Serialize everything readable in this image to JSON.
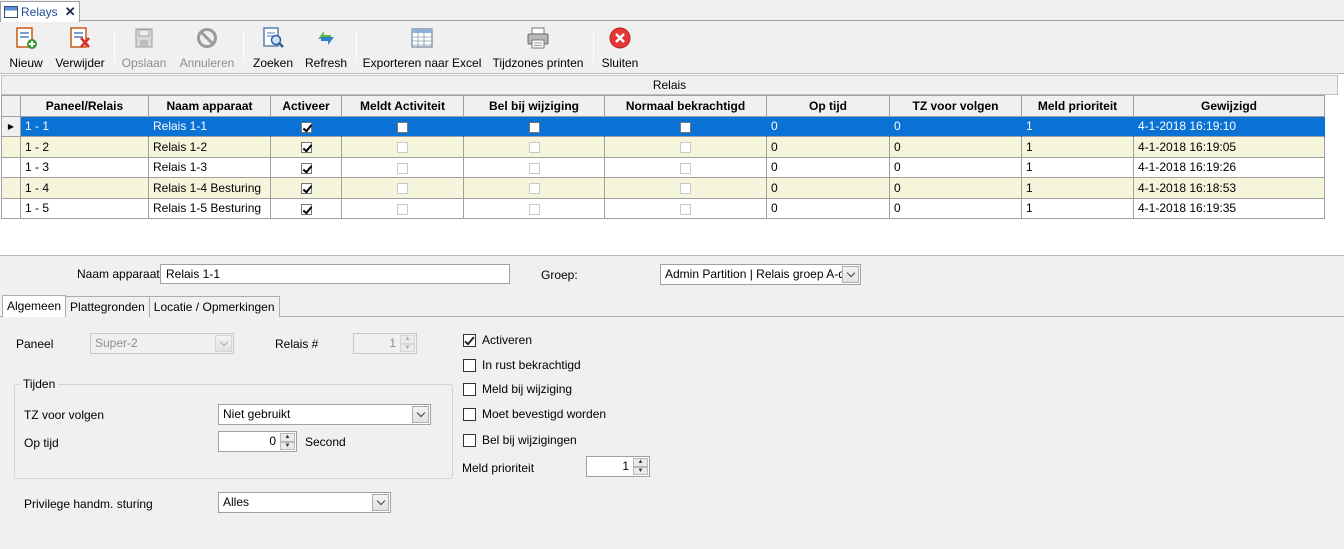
{
  "document_tab": {
    "title": "Relays",
    "close_glyph": "✕"
  },
  "toolbar": {
    "buttons": [
      {
        "label": "Nieuw",
        "icon": "new-record-icon",
        "enabled": true
      },
      {
        "label": "Verwijder",
        "icon": "delete-record-icon",
        "enabled": true
      },
      {
        "label": "Opslaan",
        "icon": "save-icon",
        "enabled": false
      },
      {
        "label": "Annuleren",
        "icon": "cancel-icon",
        "enabled": false
      },
      {
        "label": "Zoeken",
        "icon": "search-icon",
        "enabled": true
      },
      {
        "label": "Refresh",
        "icon": "refresh-icon",
        "enabled": true
      },
      {
        "label": "Exporteren naar Excel",
        "icon": "excel-export-icon",
        "enabled": true
      },
      {
        "label": "Tijdzones printen",
        "icon": "printer-icon",
        "enabled": true
      },
      {
        "label": "Sluiten",
        "icon": "close-circle-icon",
        "enabled": true
      }
    ]
  },
  "grid": {
    "group_title": "Relais",
    "columns": [
      "Paneel/Relais",
      "Naam apparaat",
      "Activeer",
      "Meldt Activiteit",
      "Bel bij wijziging",
      "Normaal bekrachtigd",
      "Op tijd",
      "TZ voor volgen",
      "Meld prioriteit",
      "Gewijzigd"
    ],
    "selected_row_marker": "▶",
    "rows": [
      {
        "panel": "1 - 1",
        "name": "Relais 1-1",
        "activeer": true,
        "meldt": false,
        "bel": false,
        "normaal": false,
        "optijd": "0",
        "tz": "0",
        "prio": "1",
        "gewijzigd": "4-1-2018 16:19:10",
        "selected": true
      },
      {
        "panel": "1 - 2",
        "name": "Relais 1-2",
        "activeer": true,
        "meldt": false,
        "bel": false,
        "normaal": false,
        "optijd": "0",
        "tz": "0",
        "prio": "1",
        "gewijzigd": "4-1-2018 16:19:05",
        "selected": false
      },
      {
        "panel": "1 - 3",
        "name": "Relais 1-3",
        "activeer": true,
        "meldt": false,
        "bel": false,
        "normaal": false,
        "optijd": "0",
        "tz": "0",
        "prio": "1",
        "gewijzigd": "4-1-2018 16:19:26",
        "selected": false
      },
      {
        "panel": "1 - 4",
        "name": "Relais 1-4 Besturing",
        "activeer": true,
        "meldt": false,
        "bel": false,
        "normaal": false,
        "optijd": "0",
        "tz": "0",
        "prio": "1",
        "gewijzigd": "4-1-2018 16:18:53",
        "selected": false
      },
      {
        "panel": "1 - 5",
        "name": "Relais 1-5 Besturing",
        "activeer": true,
        "meldt": false,
        "bel": false,
        "normaal": false,
        "optijd": "0",
        "tz": "0",
        "prio": "1",
        "gewijzigd": "4-1-2018 16:19:35",
        "selected": false
      }
    ]
  },
  "detail": {
    "name_label": "Naam apparaat",
    "name_value": "Relais 1-1",
    "group_label": "Groep:",
    "group_value": "Admin Partition | Relais groep A-d",
    "tabs": [
      "Algemeen",
      "Plattegronden",
      "Locatie / Opmerkingen"
    ],
    "paneel_label": "Paneel",
    "paneel_value": "Super-2",
    "relais_label": "Relais #",
    "relais_value": "1",
    "tijden_title": "Tijden",
    "tz_label": "TZ voor volgen",
    "tz_value": "Niet gebruikt",
    "optijd_label": "Op tijd",
    "optijd_value": "0",
    "optijd_unit": "Second",
    "privilege_label": "Privilege handm. sturing",
    "privilege_value": "Alles",
    "checkboxes": [
      {
        "label": "Activeren",
        "checked": true
      },
      {
        "label": "In rust bekrachtigd",
        "checked": false
      },
      {
        "label": "Meld bij wijziging",
        "checked": false
      },
      {
        "label": "Moet bevestigd worden",
        "checked": false
      },
      {
        "label": "Bel bij wijzigingen",
        "checked": false
      }
    ],
    "prio_label": "Meld prioriteit",
    "prio_value": "1"
  },
  "colors": {
    "selection": "#0a72d4",
    "alt_row": "#f5f5dc",
    "tab_text": "#1d4f91"
  }
}
